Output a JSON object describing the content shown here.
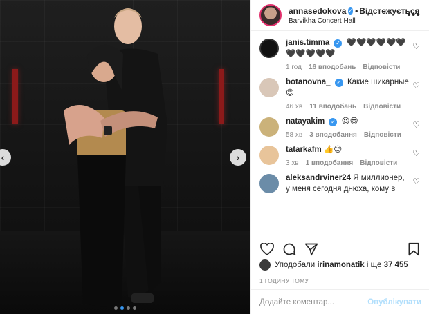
{
  "post": {
    "carousel": {
      "total": 4,
      "active": 2
    },
    "nav": {
      "prev": "‹",
      "next": "›"
    }
  },
  "header": {
    "username": "annasedokova",
    "separator": "•",
    "follow_label": "Відстежується",
    "location": "Barvikha Concert Hall",
    "more_icon": "•••"
  },
  "comments": [
    {
      "username": "janis.timma",
      "verified": true,
      "text": "🖤🖤🖤🖤🖤🖤🖤🖤🖤🖤🖤",
      "time": "1 год",
      "likes": "16 вподобань",
      "reply": "Відповісти",
      "avatar_color": "#111111"
    },
    {
      "username": "botanovna_",
      "verified": true,
      "text": "Какие шикарные 😍",
      "time": "46 хв",
      "likes": "11 вподобань",
      "reply": "Відповісти",
      "avatar_color": "#d9c7b8"
    },
    {
      "username": "natayakim",
      "verified": true,
      "text": "😍😍",
      "time": "58 хв",
      "likes": "3 вподобання",
      "reply": "Відповісти",
      "avatar_color": "#cbb27a"
    },
    {
      "username": "tatarkafm",
      "verified": false,
      "text": "👍😉",
      "time": "3 хв",
      "likes": "1 вподобання",
      "reply": "Відповісти",
      "avatar_color": "#e8c49a"
    },
    {
      "username": "aleksandrviner24",
      "verified": false,
      "text": "Я миллионер, у меня сегодня днюха, кому в",
      "time": "",
      "likes": "",
      "reply": "",
      "avatar_color": "#6b8ca8"
    }
  ],
  "likes": {
    "prefix": "Уподобали",
    "user": "irinamonatik",
    "middle": "і ще",
    "count": "37 455"
  },
  "time_ago": "1 ГОДИНУ ТОМУ",
  "add_comment": {
    "placeholder": "Додайте коментар...",
    "publish": "Опублікувати"
  },
  "icons": {
    "heart": "heart-icon",
    "comment": "comment-icon",
    "share": "share-icon",
    "bookmark": "bookmark-icon"
  },
  "colors": {
    "accent": "#3897f0",
    "publish_disabled": "#b2dffc",
    "meta": "#8e8e8e"
  }
}
